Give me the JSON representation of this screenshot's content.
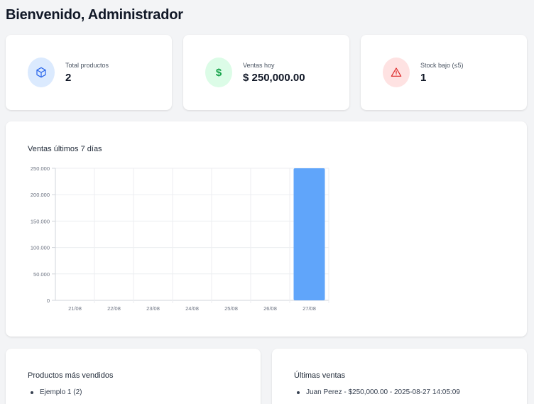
{
  "header": {
    "title": "Bienvenido, Administrador"
  },
  "stats": [
    {
      "icon": "box-icon",
      "label": "Total productos",
      "value": "2",
      "icon_bg": "#dbeafe",
      "icon_color": "#2563eb"
    },
    {
      "icon": "dollar-icon",
      "label": "Ventas hoy",
      "value": "$ 250,000.00",
      "icon_bg": "#dcfce7",
      "icon_color": "#16a34a"
    },
    {
      "icon": "warning-icon",
      "label": "Stock bajo (≤5)",
      "value": "1",
      "icon_bg": "#fee2e2",
      "icon_color": "#dc2626"
    }
  ],
  "chart_data": {
    "type": "bar",
    "title": "Ventas últimos 7 días",
    "categories": [
      "21/08",
      "22/08",
      "23/08",
      "24/08",
      "25/08",
      "26/08",
      "27/08"
    ],
    "values": [
      0,
      0,
      0,
      0,
      0,
      0,
      250000
    ],
    "ylim": [
      0,
      250000
    ],
    "yticks": [
      0,
      50000,
      100000,
      150000,
      200000,
      250000
    ],
    "ytick_labels": [
      "0",
      "50.000",
      "100.000",
      "150.000",
      "200.000",
      "250.000"
    ],
    "bar_color": "#60a5fa",
    "grid": true
  },
  "top_products": {
    "title": "Productos más vendidos",
    "items": [
      "Ejemplo 1 (2)"
    ]
  },
  "recent_sales": {
    "title": "Últimas ventas",
    "items": [
      "Juan Perez - $250,000.00 - 2025-08-27 14:05:09"
    ]
  }
}
